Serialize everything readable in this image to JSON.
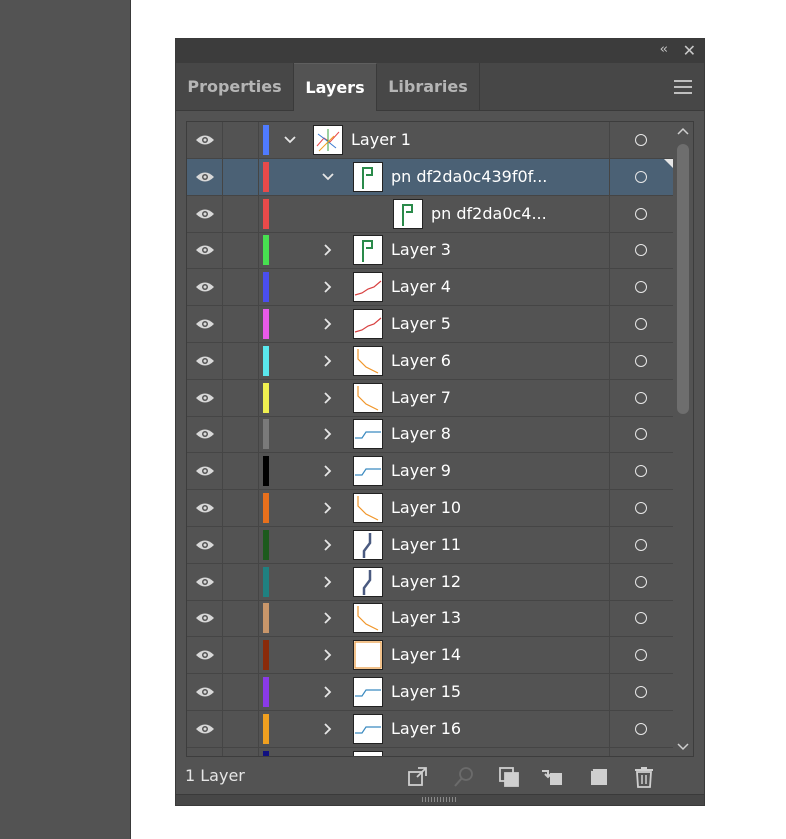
{
  "panel": {
    "tabs": [
      {
        "label": "Properties",
        "active": false
      },
      {
        "label": "Layers",
        "active": true
      },
      {
        "label": "Libraries",
        "active": false
      }
    ],
    "status": "1 Layer"
  },
  "colors": {
    "selected_row": "#4b6175",
    "panel_bg": "#535353"
  },
  "layers": [
    {
      "name": "Layer 1",
      "color": "#4f7bff",
      "level": 0,
      "expanded": true,
      "thumb": "map-icon"
    },
    {
      "name": "pn df2da0c439f0f...",
      "color": "#e84a4a",
      "level": 1,
      "expanded": true,
      "selected": true,
      "thumb": "flag-icon"
    },
    {
      "name": "pn df2da0c4...",
      "color": "#e84a4a",
      "level": 2,
      "leaf": true,
      "thumb": "flag-icon"
    },
    {
      "name": "Layer 3",
      "color": "#47e050",
      "level": 1,
      "thumb": "flag-icon"
    },
    {
      "name": "Layer 4",
      "color": "#4a4ef0",
      "level": 1,
      "thumb": "line-red-icon"
    },
    {
      "name": "Layer 5",
      "color": "#e85ae8",
      "level": 1,
      "thumb": "line-red-icon"
    },
    {
      "name": "Layer 6",
      "color": "#5ae8ee",
      "level": 1,
      "thumb": "line-orange-icon"
    },
    {
      "name": "Layer 7",
      "color": "#f0f050",
      "level": 1,
      "thumb": "line-orange-icon"
    },
    {
      "name": "Layer 8",
      "color": "#7a7a7a",
      "level": 1,
      "thumb": "line-blue-icon"
    },
    {
      "name": "Layer 9",
      "color": "#000000",
      "level": 1,
      "thumb": "line-blue-icon"
    },
    {
      "name": "Layer 10",
      "color": "#e8701c",
      "level": 1,
      "thumb": "line-orange-icon"
    },
    {
      "name": "Layer 11",
      "color": "#1d5a1d",
      "level": 1,
      "thumb": "line-slate-icon"
    },
    {
      "name": "Layer 12",
      "color": "#1f8080",
      "level": 1,
      "thumb": "line-slate-icon"
    },
    {
      "name": "Layer 13",
      "color": "#c8966a",
      "level": 1,
      "thumb": "line-orange-icon"
    },
    {
      "name": "Layer 14",
      "color": "#8a2a0a",
      "level": 1,
      "thumb": "box-orange-icon"
    },
    {
      "name": "Layer 15",
      "color": "#8a3ae8",
      "level": 1,
      "thumb": "line-blue-icon"
    },
    {
      "name": "Layer 16",
      "color": "#f0a020",
      "level": 1,
      "thumb": "line-blue-icon"
    },
    {
      "name": "",
      "color": "#101080",
      "level": 1,
      "thumb": "line-red-icon",
      "partial": true
    }
  ],
  "icons": {
    "collapse": "double-chevron-left-icon",
    "close": "close-icon",
    "menu": "hamburger-menu-icon",
    "footer": [
      "export-to-screen-icon",
      "locate-object-icon",
      "make-clipping-mask-icon",
      "merge-selected-icon",
      "create-new-layer-icon",
      "delete-icon"
    ]
  }
}
